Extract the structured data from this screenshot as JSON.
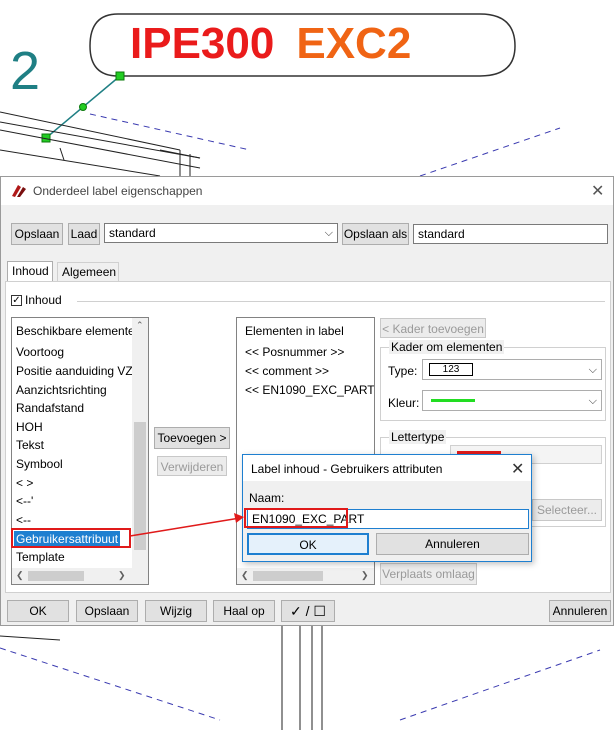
{
  "canvas": {
    "label_part1": "IPE300",
    "label_part2": "EXC2",
    "view_number": "2"
  },
  "dialog": {
    "title": "Onderdeel label eigenschappen",
    "save_label": "Opslaan",
    "load_label": "Laad",
    "preset_value": "standard",
    "save_as_label": "Opslaan als",
    "save_as_value": "standard",
    "tabs": [
      "Inhoud",
      "Algemeen"
    ],
    "content_checkbox_label": "Inhoud",
    "available_header": "Beschikbare elemente",
    "available_items": [
      "Voortoog",
      "Positie aanduiding VZ",
      "Aanzichtsrichting",
      "Randafstand",
      "HOH",
      "Tekst",
      "Symbool",
      "< >",
      "<--'",
      "<--",
      "Gebruikersattribuut",
      "Template"
    ],
    "selected_index": 10,
    "add_label": "Toevoegen >",
    "remove_label": "Verwijderen",
    "label_elements_header": "Elementen in label",
    "label_elements": [
      "<< Posnummer >>",
      "<< comment >>",
      "<< EN1090_EXC_PART >>"
    ],
    "add_frame_label": "< Kader toevoegen",
    "frame_group_title": "Kader om elementen",
    "type_label": "Type:",
    "type_value": "123",
    "color_label": "Kleur:",
    "frame_color": "#22dd22",
    "font_group_title": "Lettertype",
    "font_color": "#e01a1a",
    "select_label": "Selecteer...",
    "move_down_label": "Verplaats omlaag",
    "ok_label": "OK",
    "save_bottom_label": "Opslaan",
    "modify_label": "Wijzig",
    "get_label": "Haal op",
    "check_toggle": "✓ / ☐",
    "cancel_label": "Annuleren"
  },
  "popup": {
    "title": "Label inhoud - Gebruikers attributen",
    "name_label": "Naam:",
    "name_value": "EN1090_EXC_PART",
    "ok_label": "OK",
    "cancel_label": "Annuleren"
  },
  "colors": {
    "highlight": "#e01a1a",
    "selection": "#1e7fd0"
  }
}
